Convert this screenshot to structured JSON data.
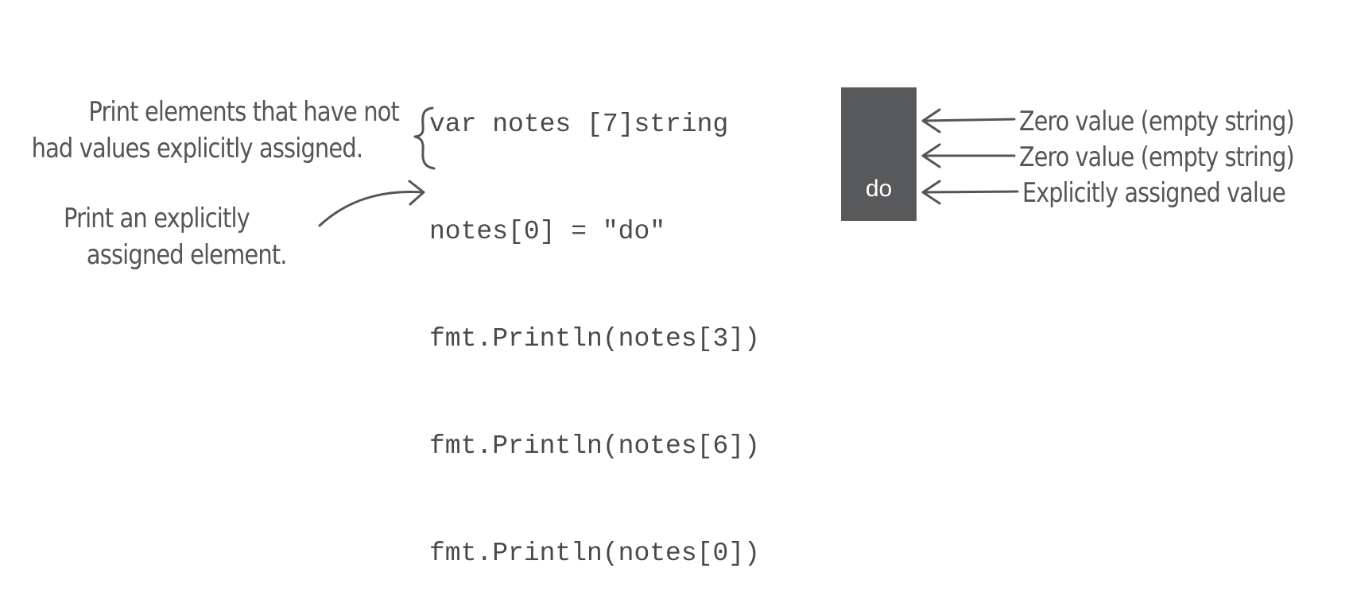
{
  "code": {
    "lines": [
      "var notes [7]string",
      "notes[0] = \"do\"",
      "fmt.Println(notes[3])",
      "fmt.Println(notes[6])",
      "fmt.Println(notes[0])"
    ]
  },
  "annotations": {
    "unassigned_line1": "Print elements that have not",
    "unassigned_line2": "had values explicitly assigned.",
    "assigned_line1": "Print an explicitly",
    "assigned_line2": "assigned element."
  },
  "output": {
    "values": [
      "",
      "",
      "do"
    ],
    "labels": [
      "Zero value (empty string)",
      "Zero value (empty string)",
      "Explicitly assigned value"
    ],
    "box_color": "#58595b",
    "text_color": "#ffffff"
  },
  "colors": {
    "ink": "#555555",
    "code": "#4a4a4a"
  }
}
